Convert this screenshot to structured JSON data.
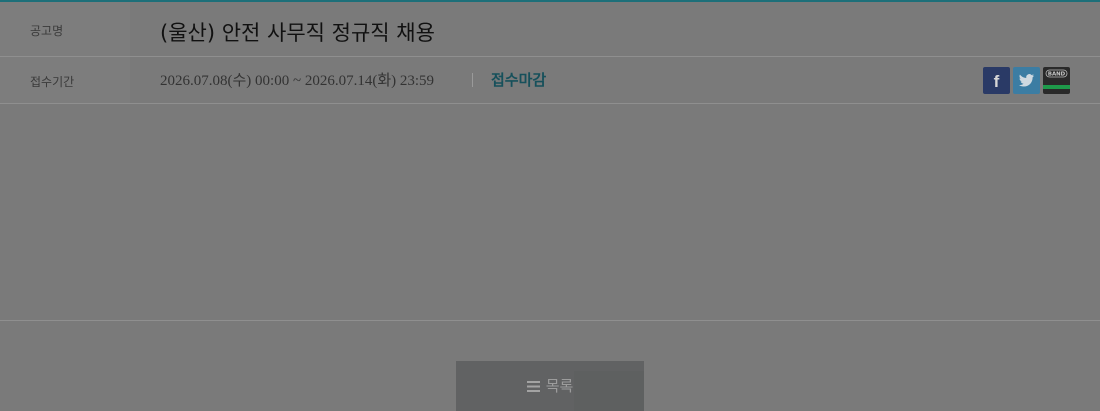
{
  "notice": {
    "title_label": "공고명",
    "title": "(울산) 안전 사무직 정규직 채용",
    "period_label": "접수기간",
    "period": "2026.07.08(수) 00:00 ~ 2026.07.14(화) 23:59",
    "status": "접수마감"
  },
  "share": {
    "facebook_icon": "f",
    "twitter_icon": "twitter-bird",
    "band_icon": "BAND",
    "colors": {
      "facebook": "#2a3a66",
      "twitter": "#3c7da3",
      "band": "#2a2a2a",
      "band_stripe": "#1e9a4a"
    }
  },
  "list_button": {
    "label": "목록",
    "icon": "menu-icon"
  },
  "colors": {
    "accent_line": "#1d6f79",
    "status": "#16505b"
  }
}
